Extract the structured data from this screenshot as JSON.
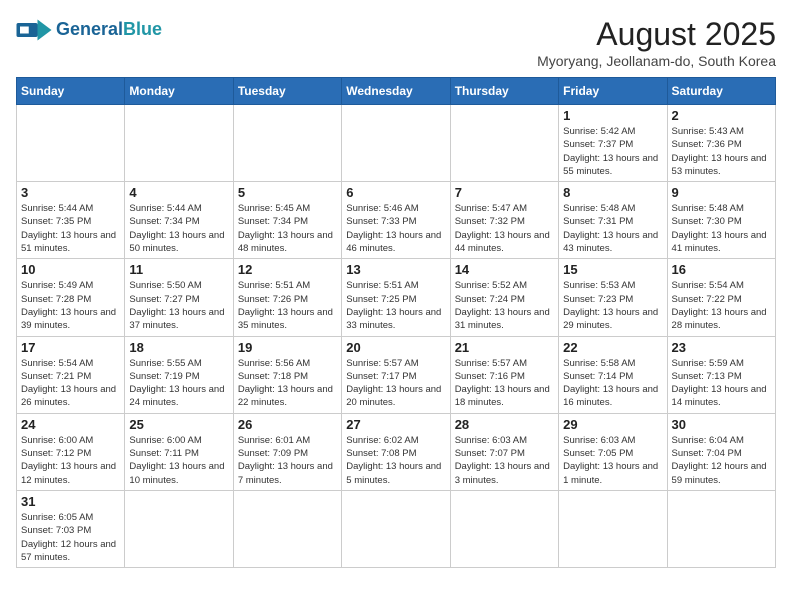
{
  "header": {
    "logo_general": "General",
    "logo_blue": "Blue",
    "month_year": "August 2025",
    "location": "Myoryang, Jeollanam-do, South Korea"
  },
  "weekdays": [
    "Sunday",
    "Monday",
    "Tuesday",
    "Wednesday",
    "Thursday",
    "Friday",
    "Saturday"
  ],
  "weeks": [
    [
      {
        "day": "",
        "info": ""
      },
      {
        "day": "",
        "info": ""
      },
      {
        "day": "",
        "info": ""
      },
      {
        "day": "",
        "info": ""
      },
      {
        "day": "",
        "info": ""
      },
      {
        "day": "1",
        "info": "Sunrise: 5:42 AM\nSunset: 7:37 PM\nDaylight: 13 hours and 55 minutes."
      },
      {
        "day": "2",
        "info": "Sunrise: 5:43 AM\nSunset: 7:36 PM\nDaylight: 13 hours and 53 minutes."
      }
    ],
    [
      {
        "day": "3",
        "info": "Sunrise: 5:44 AM\nSunset: 7:35 PM\nDaylight: 13 hours and 51 minutes."
      },
      {
        "day": "4",
        "info": "Sunrise: 5:44 AM\nSunset: 7:34 PM\nDaylight: 13 hours and 50 minutes."
      },
      {
        "day": "5",
        "info": "Sunrise: 5:45 AM\nSunset: 7:34 PM\nDaylight: 13 hours and 48 minutes."
      },
      {
        "day": "6",
        "info": "Sunrise: 5:46 AM\nSunset: 7:33 PM\nDaylight: 13 hours and 46 minutes."
      },
      {
        "day": "7",
        "info": "Sunrise: 5:47 AM\nSunset: 7:32 PM\nDaylight: 13 hours and 44 minutes."
      },
      {
        "day": "8",
        "info": "Sunrise: 5:48 AM\nSunset: 7:31 PM\nDaylight: 13 hours and 43 minutes."
      },
      {
        "day": "9",
        "info": "Sunrise: 5:48 AM\nSunset: 7:30 PM\nDaylight: 13 hours and 41 minutes."
      }
    ],
    [
      {
        "day": "10",
        "info": "Sunrise: 5:49 AM\nSunset: 7:28 PM\nDaylight: 13 hours and 39 minutes."
      },
      {
        "day": "11",
        "info": "Sunrise: 5:50 AM\nSunset: 7:27 PM\nDaylight: 13 hours and 37 minutes."
      },
      {
        "day": "12",
        "info": "Sunrise: 5:51 AM\nSunset: 7:26 PM\nDaylight: 13 hours and 35 minutes."
      },
      {
        "day": "13",
        "info": "Sunrise: 5:51 AM\nSunset: 7:25 PM\nDaylight: 13 hours and 33 minutes."
      },
      {
        "day": "14",
        "info": "Sunrise: 5:52 AM\nSunset: 7:24 PM\nDaylight: 13 hours and 31 minutes."
      },
      {
        "day": "15",
        "info": "Sunrise: 5:53 AM\nSunset: 7:23 PM\nDaylight: 13 hours and 29 minutes."
      },
      {
        "day": "16",
        "info": "Sunrise: 5:54 AM\nSunset: 7:22 PM\nDaylight: 13 hours and 28 minutes."
      }
    ],
    [
      {
        "day": "17",
        "info": "Sunrise: 5:54 AM\nSunset: 7:21 PM\nDaylight: 13 hours and 26 minutes."
      },
      {
        "day": "18",
        "info": "Sunrise: 5:55 AM\nSunset: 7:19 PM\nDaylight: 13 hours and 24 minutes."
      },
      {
        "day": "19",
        "info": "Sunrise: 5:56 AM\nSunset: 7:18 PM\nDaylight: 13 hours and 22 minutes."
      },
      {
        "day": "20",
        "info": "Sunrise: 5:57 AM\nSunset: 7:17 PM\nDaylight: 13 hours and 20 minutes."
      },
      {
        "day": "21",
        "info": "Sunrise: 5:57 AM\nSunset: 7:16 PM\nDaylight: 13 hours and 18 minutes."
      },
      {
        "day": "22",
        "info": "Sunrise: 5:58 AM\nSunset: 7:14 PM\nDaylight: 13 hours and 16 minutes."
      },
      {
        "day": "23",
        "info": "Sunrise: 5:59 AM\nSunset: 7:13 PM\nDaylight: 13 hours and 14 minutes."
      }
    ],
    [
      {
        "day": "24",
        "info": "Sunrise: 6:00 AM\nSunset: 7:12 PM\nDaylight: 13 hours and 12 minutes."
      },
      {
        "day": "25",
        "info": "Sunrise: 6:00 AM\nSunset: 7:11 PM\nDaylight: 13 hours and 10 minutes."
      },
      {
        "day": "26",
        "info": "Sunrise: 6:01 AM\nSunset: 7:09 PM\nDaylight: 13 hours and 7 minutes."
      },
      {
        "day": "27",
        "info": "Sunrise: 6:02 AM\nSunset: 7:08 PM\nDaylight: 13 hours and 5 minutes."
      },
      {
        "day": "28",
        "info": "Sunrise: 6:03 AM\nSunset: 7:07 PM\nDaylight: 13 hours and 3 minutes."
      },
      {
        "day": "29",
        "info": "Sunrise: 6:03 AM\nSunset: 7:05 PM\nDaylight: 13 hours and 1 minute."
      },
      {
        "day": "30",
        "info": "Sunrise: 6:04 AM\nSunset: 7:04 PM\nDaylight: 12 hours and 59 minutes."
      }
    ],
    [
      {
        "day": "31",
        "info": "Sunrise: 6:05 AM\nSunset: 7:03 PM\nDaylight: 12 hours and 57 minutes."
      },
      {
        "day": "",
        "info": ""
      },
      {
        "day": "",
        "info": ""
      },
      {
        "day": "",
        "info": ""
      },
      {
        "day": "",
        "info": ""
      },
      {
        "day": "",
        "info": ""
      },
      {
        "day": "",
        "info": ""
      }
    ]
  ]
}
